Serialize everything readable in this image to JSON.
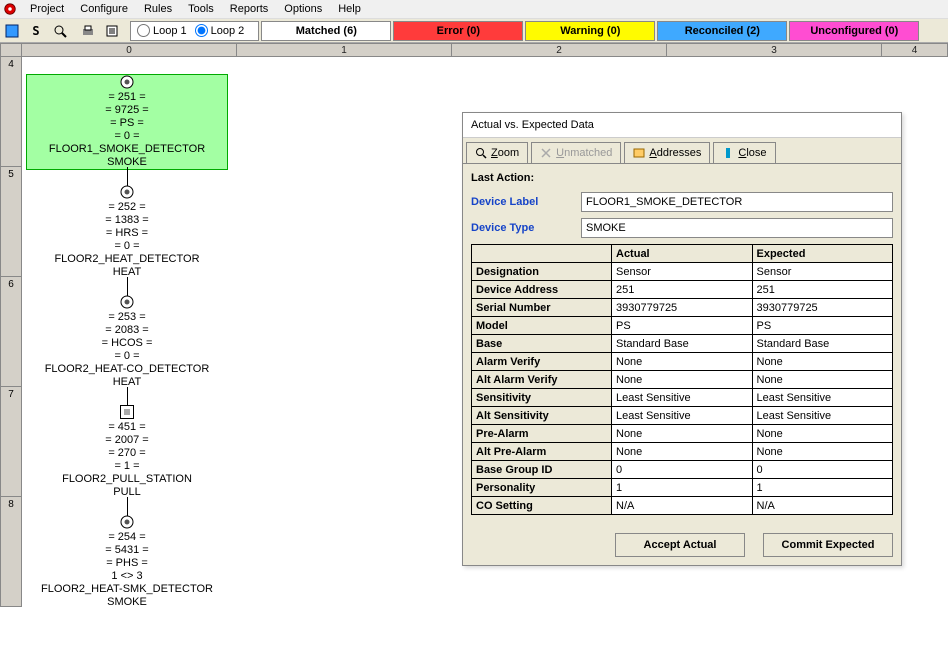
{
  "menu": {
    "items": [
      "Project",
      "Configure",
      "Rules",
      "Tools",
      "Reports",
      "Options",
      "Help"
    ]
  },
  "loops": {
    "loop1": "Loop 1",
    "loop2": "Loop 2",
    "selected": "loop2"
  },
  "status": {
    "matched": "Matched (6)",
    "error": "Error (0)",
    "warning": "Warning (0)",
    "reconciled": "Reconciled (2)",
    "unconfigured": "Unconfigured (0)"
  },
  "ruler_cols": [
    "0",
    "1",
    "2",
    "3",
    "4"
  ],
  "ruler_rows": [
    "4",
    "5",
    "6",
    "7",
    "8"
  ],
  "devices": [
    {
      "addr": "= 251 =",
      "serial": "= 9725 =",
      "model": "= PS =",
      "extra": "= 0 =",
      "label": "FLOOR1_SMOKE_DETECTOR",
      "type": "SMOKE",
      "icon": "circle",
      "highlight": true
    },
    {
      "addr": "= 252 =",
      "serial": "= 1383 =",
      "model": "= HRS =",
      "extra": "= 0 =",
      "label": "FLOOR2_HEAT_DETECTOR",
      "type": "HEAT",
      "icon": "circle",
      "highlight": false
    },
    {
      "addr": "= 253 =",
      "serial": "= 2083 =",
      "model": "= HCOS =",
      "extra": "= 0 =",
      "label": "FLOOR2_HEAT-CO_DETECTOR",
      "type": "HEAT",
      "icon": "circle",
      "highlight": false
    },
    {
      "addr": "= 451 =",
      "serial": "= 2007 =",
      "model": "= 270 =",
      "extra": "= 1 =",
      "label": "FLOOR2_PULL_STATION",
      "type": "PULL",
      "icon": "square",
      "highlight": false
    },
    {
      "addr": "= 254 =",
      "serial": "= 5431 =",
      "model": "= PHS =",
      "extra": "1 <> 3",
      "label": "FLOOR2_HEAT-SMK_DETECTOR",
      "type": "SMOKE",
      "icon": "circle",
      "highlight": false
    }
  ],
  "dialog": {
    "title": "Actual vs. Expected Data",
    "tabs": {
      "zoom": "Zoom",
      "unmatched": "Unmatched",
      "addresses": "Addresses",
      "close": "Close"
    },
    "last_action_label": "Last Action:",
    "device_label_lbl": "Device Label",
    "device_label_val": "FLOOR1_SMOKE_DETECTOR",
    "device_type_lbl": "Device Type",
    "device_type_val": "SMOKE",
    "columns": [
      "",
      "Actual",
      "Expected"
    ],
    "rows": [
      {
        "k": "Designation",
        "a": "Sensor",
        "e": "Sensor"
      },
      {
        "k": "Device Address",
        "a": "251",
        "e": "251"
      },
      {
        "k": "Serial Number",
        "a": "3930779725",
        "e": "3930779725"
      },
      {
        "k": "Model",
        "a": "PS",
        "e": "PS"
      },
      {
        "k": "Base",
        "a": "Standard Base",
        "e": "Standard Base"
      },
      {
        "k": "Alarm Verify",
        "a": "None",
        "e": "None"
      },
      {
        "k": "Alt Alarm Verify",
        "a": "None",
        "e": "None"
      },
      {
        "k": "Sensitivity",
        "a": "Least Sensitive",
        "e": "Least Sensitive"
      },
      {
        "k": "Alt Sensitivity",
        "a": "Least Sensitive",
        "e": "Least Sensitive"
      },
      {
        "k": "Pre-Alarm",
        "a": "None",
        "e": "None"
      },
      {
        "k": "Alt Pre-Alarm",
        "a": "None",
        "e": "None"
      },
      {
        "k": "Base Group ID",
        "a": "0",
        "e": "0"
      },
      {
        "k": "Personality",
        "a": "1",
        "e": "1"
      },
      {
        "k": "CO Setting",
        "a": "N/A",
        "e": "N/A"
      }
    ],
    "accept_btn": "Accept Actual",
    "commit_btn": "Commit Expected"
  }
}
